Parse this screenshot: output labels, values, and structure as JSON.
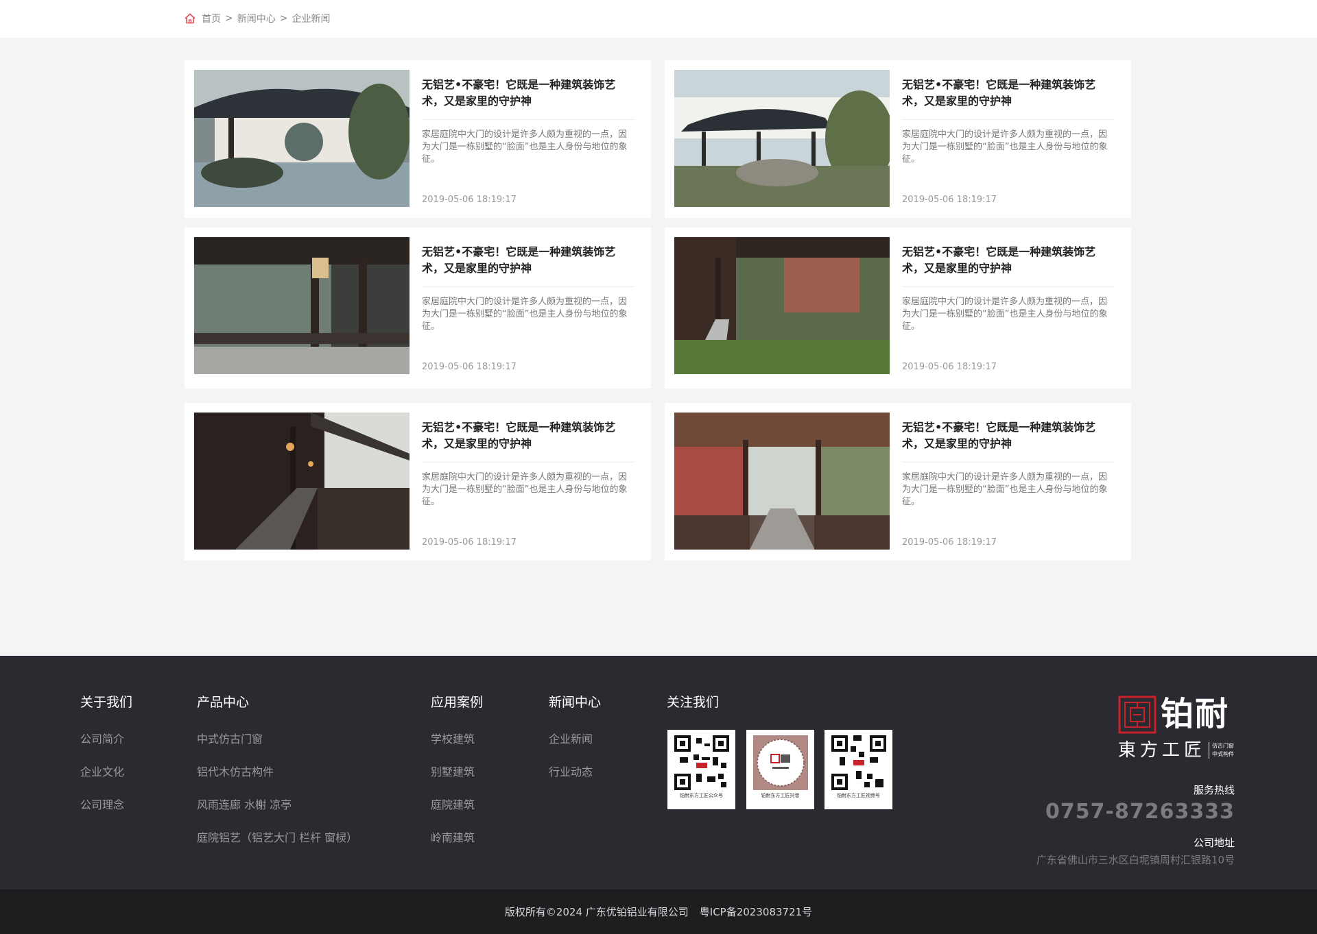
{
  "breadcrumb": {
    "home": "首页",
    "sep": ">",
    "level2": "新闻中心",
    "level3": "企业新闻"
  },
  "news": [
    {
      "title": "无铝艺•不豪宅！它既是一种建筑装饰艺术，又是家里的守护神",
      "desc": "家居庭院中大门的设计是许多人颇为重视的一点，因为大门是一栋别墅的“脸面”也是主人身份与地位的象征。",
      "date": "2019-05-06 18:19:17"
    },
    {
      "title": "无铝艺•不豪宅！它既是一种建筑装饰艺术，又是家里的守护神",
      "desc": "家居庭院中大门的设计是许多人颇为重视的一点，因为大门是一栋别墅的“脸面”也是主人身份与地位的象征。",
      "date": "2019-05-06 18:19:17"
    },
    {
      "title": "无铝艺•不豪宅！它既是一种建筑装饰艺术，又是家里的守护神",
      "desc": "家居庭院中大门的设计是许多人颇为重视的一点，因为大门是一栋别墅的“脸面”也是主人身份与地位的象征。",
      "date": "2019-05-06 18:19:17"
    },
    {
      "title": "无铝艺•不豪宅！它既是一种建筑装饰艺术，又是家里的守护神",
      "desc": "家居庭院中大门的设计是许多人颇为重视的一点，因为大门是一栋别墅的“脸面”也是主人身份与地位的象征。",
      "date": "2019-05-06 18:19:17"
    },
    {
      "title": "无铝艺•不豪宅！它既是一种建筑装饰艺术，又是家里的守护神",
      "desc": "家居庭院中大门的设计是许多人颇为重视的一点，因为大门是一栋别墅的“脸面”也是主人身份与地位的象征。",
      "date": "2019-05-06 18:19:17"
    },
    {
      "title": "无铝艺•不豪宅！它既是一种建筑装饰艺术，又是家里的守护神",
      "desc": "家居庭院中大门的设计是许多人颇为重视的一点，因为大门是一栋别墅的“脸面”也是主人身份与地位的象征。",
      "date": "2019-05-06 18:19:17"
    }
  ],
  "footer": {
    "about": {
      "title": "关于我们",
      "links": [
        "公司简介",
        "企业文化",
        "公司理念"
      ]
    },
    "products": {
      "title": "产品中心",
      "links": [
        "中式仿古门窗",
        "铝代木仿古构件",
        "风雨连廊  水榭  凉亭",
        "庭院铝艺（铝艺大门  栏杆  窗棂）"
      ]
    },
    "cases": {
      "title": "应用案例",
      "links": [
        "学校建筑",
        "别墅建筑",
        "庭院建筑",
        "岭南建筑"
      ]
    },
    "news": {
      "title": "新闻中心",
      "links": [
        "企业新闻",
        "行业动态"
      ]
    },
    "follow": {
      "title": "关注我们",
      "qrs": [
        "铂耐东方工匠公众号",
        "铂耐东方工匠抖音",
        "铂耐东方工匠视频号"
      ]
    },
    "brand": {
      "logo_text": "铂耐",
      "slogan": "東方工匠",
      "tag1": "仿古门窗",
      "tag2": "中式构件"
    },
    "hotline_label": "服务热线",
    "hotline": "0757-87263333",
    "address_label": "公司地址",
    "address": "广东省佛山市三水区白坭镇周村汇银路10号"
  },
  "copyright": {
    "text": "版权所有©2024 广东优铂铝业有限公司",
    "icp": "粤ICP备2023083721号"
  },
  "colors": {
    "accent_red": "#c8232c",
    "footer_bg": "#2b2a30",
    "copyright_bg": "#1e1e21"
  }
}
